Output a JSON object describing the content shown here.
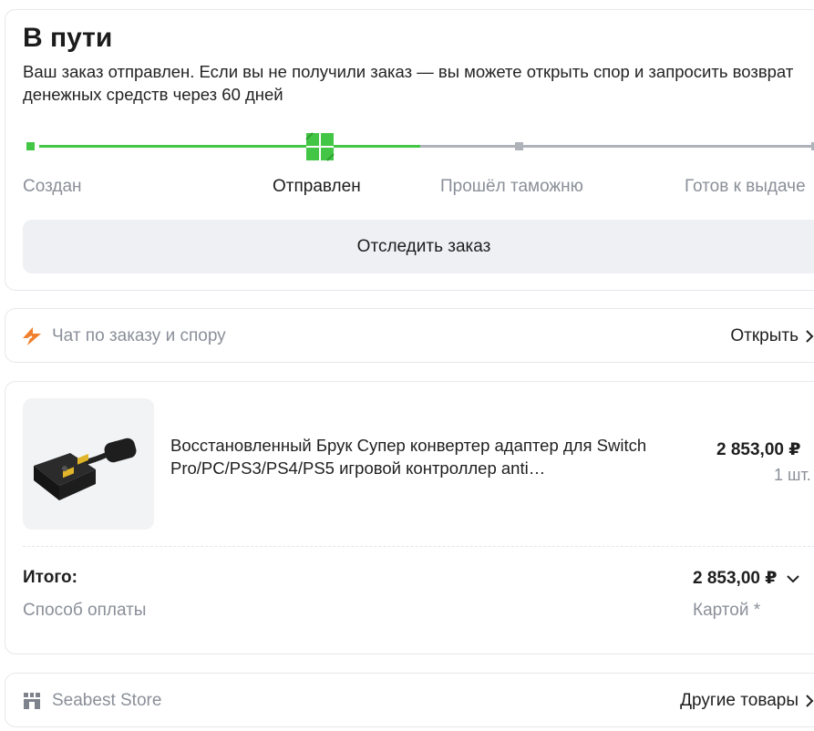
{
  "status": {
    "title": "В пути",
    "description": "Ваш заказ отправлен. Если вы не получили заказ — вы можете открыть спор и запросить возврат денежных средств через 60 дней",
    "stages": [
      {
        "label": "Создан",
        "state": "done"
      },
      {
        "label": "Отправлен",
        "state": "current"
      },
      {
        "label": "Прошёл таможню",
        "state": "pending"
      },
      {
        "label": "Готов к выдаче",
        "state": "pending"
      }
    ],
    "track_button": "Отследить заказ",
    "colors": {
      "done": "#43c545",
      "pending": "#aeb2b9"
    }
  },
  "chat": {
    "label": "Чат по заказу и спору",
    "action": "Открыть",
    "icon": "lightning-brand-icon",
    "icon_color": "#f0802d"
  },
  "product": {
    "name": "Восстановленный Брук Супер конвертер адаптер для Switch Pro/PC/PS3/PS4/PS5 игровой контроллер anti…",
    "price": "2 853,00 ₽",
    "quantity": "1 шт.",
    "total_label": "Итого:",
    "total_value": "2 853,00 ₽",
    "payment_label": "Способ оплаты",
    "payment_value": "Картой *"
  },
  "store": {
    "name": "Seabest Store",
    "action": "Другие товары",
    "icon": "store-icon"
  }
}
